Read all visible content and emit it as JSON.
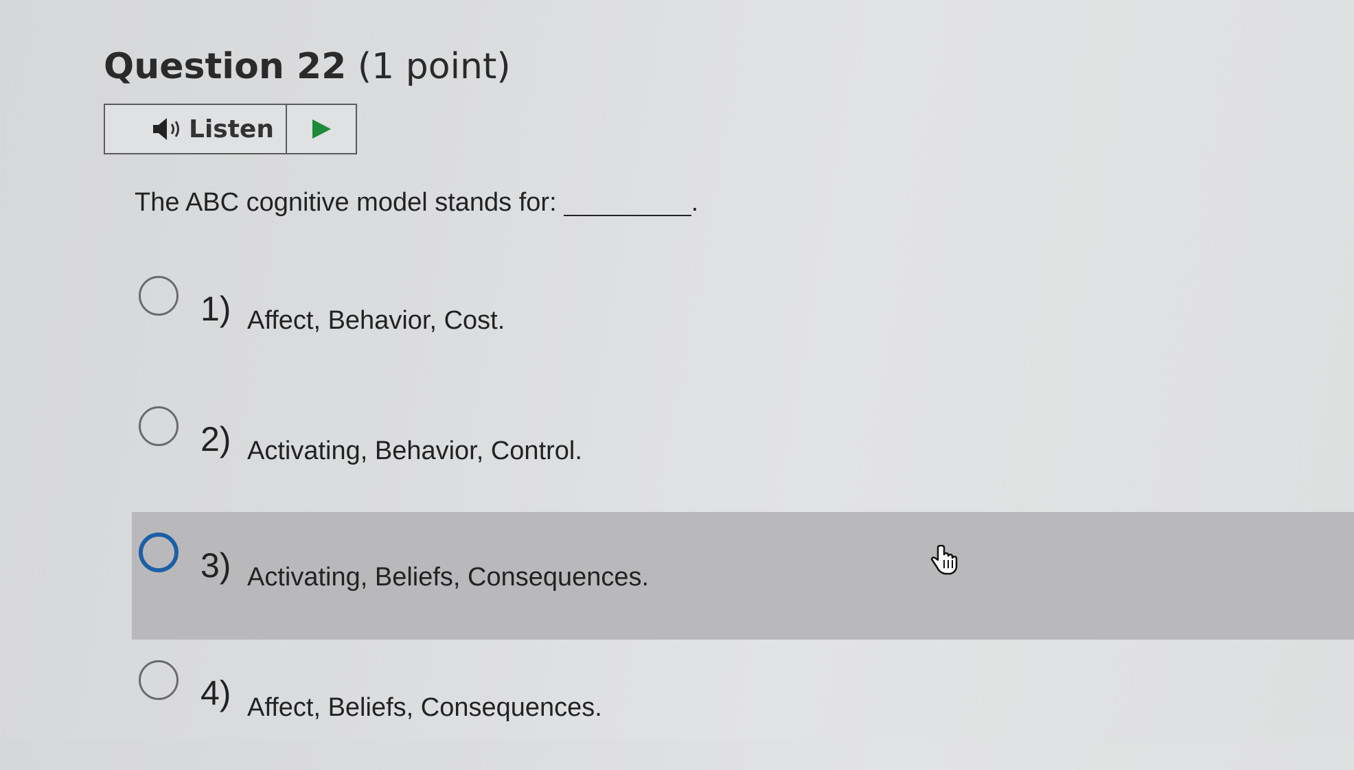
{
  "question": {
    "number_label": "Question 22",
    "points_label": "(1 point)"
  },
  "listen": {
    "label": "Listen",
    "speaker_icon": "speaker-icon",
    "play_icon": "play-icon",
    "play_color": "#1e8a3c"
  },
  "prompt": {
    "text": "The ABC cognitive model stands for:",
    "end_punct": "."
  },
  "options": [
    {
      "number": "1)",
      "text": "Affect, Behavior, Cost.",
      "selected": false,
      "hovered": false
    },
    {
      "number": "2)",
      "text": "Activating, Behavior, Control.",
      "selected": false,
      "hovered": false
    },
    {
      "number": "3)",
      "text": "Activating, Beliefs, Consequences.",
      "selected": false,
      "hovered": true
    },
    {
      "number": "4)",
      "text": "Affect, Beliefs, Consequences.",
      "selected": false,
      "hovered": false
    }
  ],
  "colors": {
    "hover_row": "#b9b9bb",
    "focus_radio": "#1d5fa6"
  },
  "cursor": "hand-pointer-icon"
}
